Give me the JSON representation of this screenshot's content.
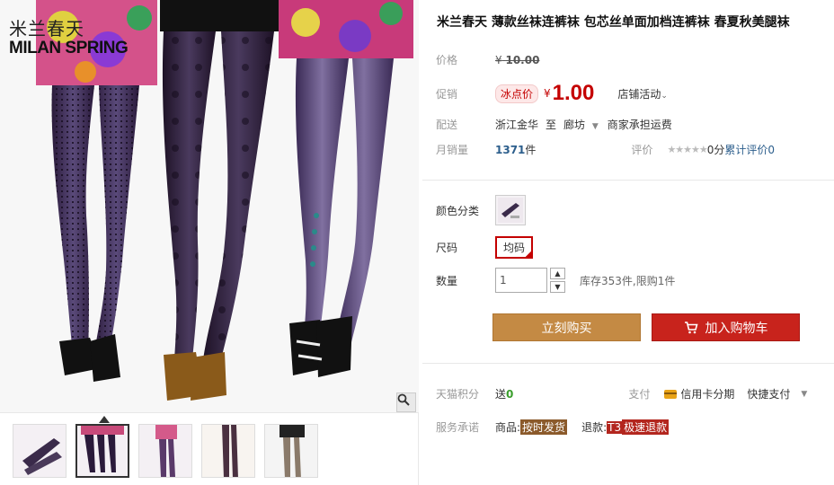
{
  "logo": {
    "cn": "米兰春天",
    "en": "MILAN SPRING"
  },
  "product": {
    "title": "米兰春天 薄款丝袜连裤袜 包芯丝单面加档连裤袜 春夏秋美腿袜"
  },
  "price": {
    "label": "价格",
    "currency": "¥",
    "original": "10.00"
  },
  "promo": {
    "label": "促销",
    "tag": "冰点价",
    "currency": "¥",
    "value": "1.00",
    "shop_activity": "店铺活动"
  },
  "delivery": {
    "label": "配送",
    "from": "浙江金华",
    "to_label": "至",
    "to": "廊坊",
    "shipping_note": "商家承担运费"
  },
  "sales": {
    "label": "月销量",
    "count": "1371",
    "unit": "件",
    "review_label": "评价",
    "stars": "★★★★★",
    "score_text": "0分",
    "review_link": "累计评价0"
  },
  "options": {
    "color_label": "颜色分类",
    "size_label": "尺码",
    "size_value": "均码",
    "qty_label": "数量",
    "qty_value": "1",
    "stock_text": "库存353件,限购1件",
    "step_up": "▲",
    "step_down": "▼"
  },
  "buttons": {
    "buy_now": "立刻购买",
    "add_cart": "加入购物车"
  },
  "points": {
    "label": "天猫积分",
    "send": "送",
    "value": "0",
    "pay_label": "支付",
    "credit": "信用卡分期",
    "quick_pay": "快捷支付",
    "dropdown": "▼"
  },
  "service": {
    "label": "服务承诺",
    "goods_label": "商品:",
    "goods_badge": "按时发货",
    "refund_label": "退款:",
    "refund_t3": "T3",
    "refund_badge": "极速退款"
  },
  "colors": {
    "accent_red": "#c40000",
    "buy_button": "#c48a44",
    "cart_button": "#c8231c",
    "link_blue": "#2c5e8c"
  },
  "icons": [
    "search-zoom-icon",
    "chevron-down-icon",
    "caret-down-icon",
    "cart-icon",
    "credit-card-icon",
    "star-icon"
  ]
}
